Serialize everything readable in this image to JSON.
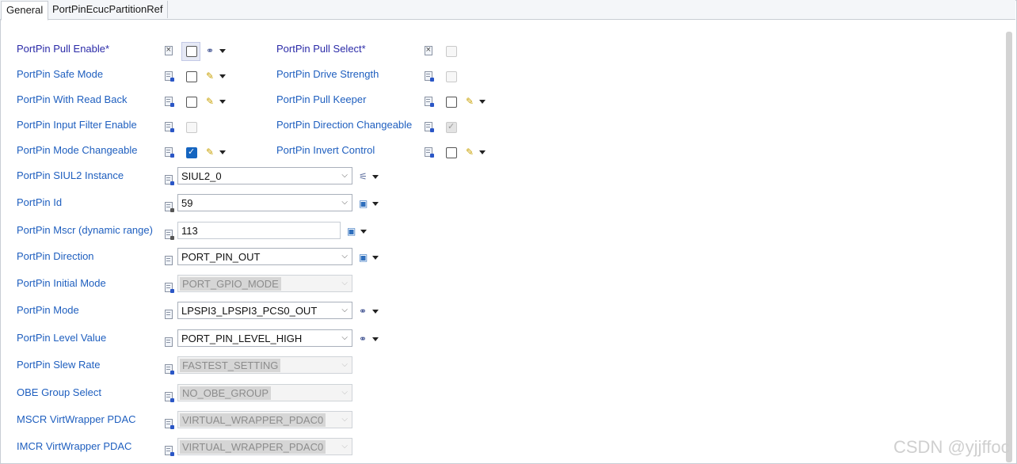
{
  "tabs": [
    {
      "label": "General",
      "active": true
    },
    {
      "label": "PortPinEcucPartitionRef",
      "active": false
    }
  ],
  "left_checkbox_rows": [
    {
      "label": "PortPin Pull Enable*",
      "required": true,
      "param_icon": "xml-param-icon",
      "checked": false,
      "enabled": true,
      "focused": true,
      "action_icon": "link-chain-icon"
    },
    {
      "label": "PortPin Safe Mode",
      "required": false,
      "param_icon": "default-param-icon",
      "checked": false,
      "enabled": true,
      "focused": false,
      "action_icon": "pencil-icon"
    },
    {
      "label": "PortPin With Read Back",
      "required": false,
      "param_icon": "default-param-icon",
      "checked": false,
      "enabled": true,
      "focused": false,
      "action_icon": "pencil-icon"
    },
    {
      "label": "PortPin Input Filter Enable",
      "required": false,
      "param_icon": "default-param-icon",
      "checked": false,
      "enabled": false,
      "focused": false,
      "action_icon": null
    },
    {
      "label": "PortPin Mode Changeable",
      "required": false,
      "param_icon": "default-param-icon",
      "checked": true,
      "enabled": true,
      "focused": false,
      "action_icon": "pencil-icon"
    }
  ],
  "right_checkbox_rows": [
    {
      "label": "PortPin Pull Select*",
      "required": true,
      "param_icon": "xml-param-icon",
      "checked": false,
      "enabled": false,
      "action_icon": null
    },
    {
      "label": "PortPin Drive Strength",
      "required": false,
      "param_icon": "default-param-icon",
      "checked": false,
      "enabled": false,
      "action_icon": null
    },
    {
      "label": "PortPin Pull Keeper",
      "required": false,
      "param_icon": "default-param-icon",
      "checked": false,
      "enabled": true,
      "action_icon": "pencil-icon"
    },
    {
      "label": "PortPin Direction Changeable",
      "required": false,
      "param_icon": "default-param-icon",
      "checked": true,
      "enabled": false,
      "action_icon": null
    },
    {
      "label": "PortPin Invert Control",
      "required": false,
      "param_icon": "default-param-icon",
      "checked": false,
      "enabled": true,
      "action_icon": "pencil-icon"
    }
  ],
  "field_rows": [
    {
      "label": "PortPin SIUL2 Instance",
      "kind": "combo",
      "value": "SIUL2_0",
      "enabled": true,
      "param_icon": "reference-param-icon",
      "action_icon": "wand-icon"
    },
    {
      "label": "PortPin Id",
      "kind": "combo",
      "value": "59",
      "enabled": true,
      "param_icon": "numeric-param-icon",
      "action_icon": "save-icon"
    },
    {
      "label": "PortPin Mscr (dynamic range)",
      "kind": "text",
      "value": "113",
      "enabled": true,
      "param_icon": "numeric-param-icon",
      "action_icon": "save-icon"
    },
    {
      "label": "PortPin Direction",
      "kind": "combo",
      "value": "PORT_PIN_OUT",
      "enabled": true,
      "param_icon": "enum-param-icon",
      "action_icon": "save-icon"
    },
    {
      "label": "PortPin Initial Mode",
      "kind": "combo",
      "value": "PORT_GPIO_MODE",
      "enabled": false,
      "param_icon": "default-param-icon",
      "action_icon": null
    },
    {
      "label": "PortPin Mode",
      "kind": "combo",
      "value": "LPSPI3_LPSPI3_PCS0_OUT",
      "enabled": true,
      "param_icon": "enum-param-icon",
      "action_icon": "link-chain-icon"
    },
    {
      "label": "PortPin Level Value",
      "kind": "combo",
      "value": "PORT_PIN_LEVEL_HIGH",
      "enabled": true,
      "param_icon": "enum-param-icon",
      "action_icon": "link-chain-icon"
    },
    {
      "label": "PortPin Slew Rate",
      "kind": "combo",
      "value": "FASTEST_SETTING",
      "enabled": false,
      "param_icon": "default-param-icon",
      "action_icon": null
    },
    {
      "label": "OBE Group Select",
      "kind": "combo",
      "value": "NO_OBE_GROUP",
      "enabled": false,
      "param_icon": "default-param-icon",
      "action_icon": null
    },
    {
      "label": "MSCR VirtWrapper PDAC",
      "kind": "combo",
      "value": "VIRTUAL_WRAPPER_PDAC0",
      "enabled": false,
      "param_icon": "default-param-icon",
      "action_icon": null
    },
    {
      "label": "IMCR VirtWrapper PDAC",
      "kind": "combo",
      "value": "VIRTUAL_WRAPPER_PDAC0",
      "enabled": false,
      "param_icon": "default-param-icon",
      "action_icon": null
    }
  ],
  "watermark": "CSDN @yjjffoc",
  "colors": {
    "label": "#1f5fbf",
    "required_label": "#2b2ba8",
    "checked": "#1565c0"
  }
}
